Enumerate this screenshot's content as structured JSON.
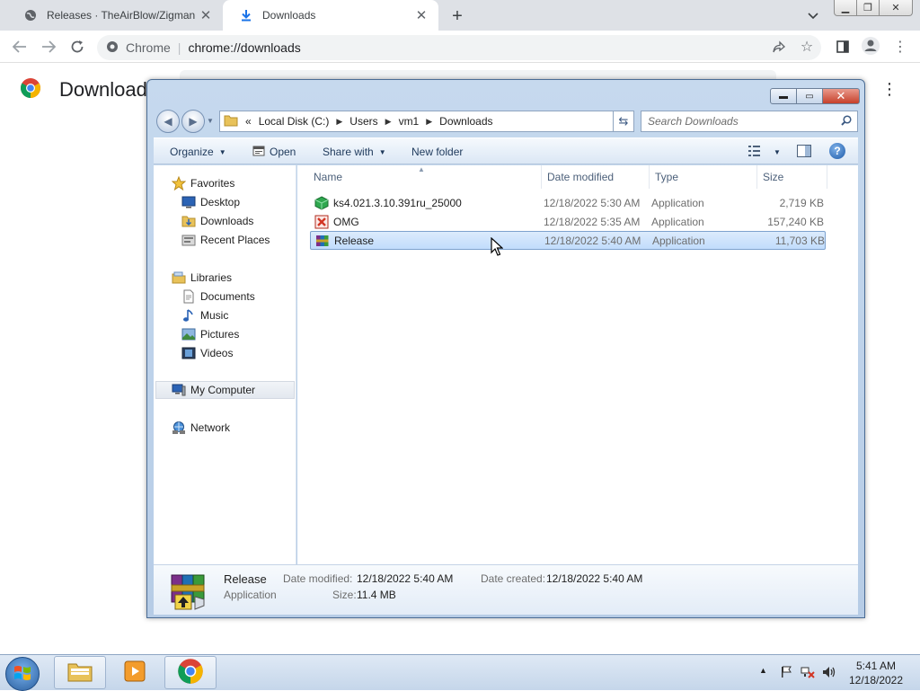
{
  "chrome": {
    "tabs": [
      {
        "title": "Releases · TheAirBlow/Zigman · G",
        "icon": "globe-icon"
      },
      {
        "title": "Downloads",
        "icon": "download-icon"
      }
    ],
    "omnibox": {
      "site": "Chrome",
      "url": "chrome://downloads"
    },
    "page_title": "Downloads"
  },
  "explorer": {
    "breadcrumb": [
      "Local Disk (C:)",
      "Users",
      "vm1",
      "Downloads"
    ],
    "search_placeholder": "Search Downloads",
    "commands": {
      "organize": "Organize",
      "open": "Open",
      "share": "Share with",
      "new_folder": "New folder"
    },
    "nav": {
      "favorites": "Favorites",
      "desktop": "Desktop",
      "downloads": "Downloads",
      "recent": "Recent Places",
      "libraries": "Libraries",
      "documents": "Documents",
      "music": "Music",
      "pictures": "Pictures",
      "videos": "Videos",
      "computer": "My Computer",
      "network": "Network"
    },
    "columns": {
      "name": "Name",
      "date": "Date modified",
      "type": "Type",
      "size": "Size"
    },
    "files": [
      {
        "name": "ks4.021.3.10.391ru_25000",
        "date": "12/18/2022 5:30 AM",
        "type": "Application",
        "size": "2,719 KB",
        "icon": "green-cube-icon"
      },
      {
        "name": "OMG",
        "date": "12/18/2022 5:35 AM",
        "type": "Application",
        "size": "157,240 KB",
        "icon": "red-x-app-icon"
      },
      {
        "name": "Release",
        "date": "12/18/2022 5:40 AM",
        "type": "Application",
        "size": "11,703 KB",
        "icon": "winrar-icon"
      }
    ],
    "details": {
      "name": "Release",
      "type": "Application",
      "modified_label": "Date modified:",
      "modified": "12/18/2022 5:40 AM",
      "created_label": "Date created:",
      "created": "12/18/2022 5:40 AM",
      "size_label": "Size:",
      "size": "11.4 MB"
    }
  },
  "taskbar": {
    "time": "5:41 AM",
    "date": "12/18/2022"
  }
}
